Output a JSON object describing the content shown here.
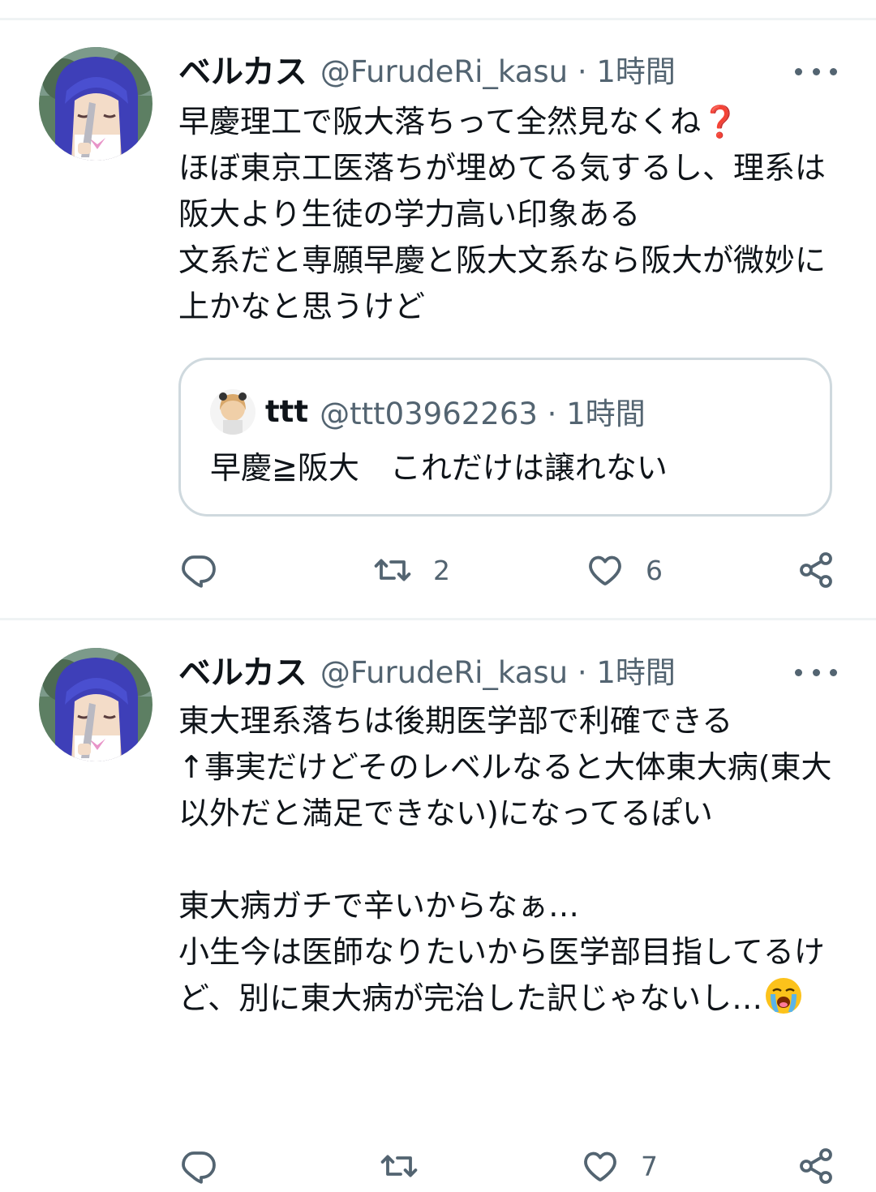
{
  "tweets": [
    {
      "name": "ベルカス",
      "meta": "@FurudeRi_kasu · 1時間",
      "text": "早慶理工で阪大落ちって全然見なくね",
      "text_emoji": "❓",
      "text_rest": "\nほぼ東京工医落ちが埋めてる気するし、理系は阪大より生徒の学力高い印象ある\n文系だと専願早慶と阪大文系なら阪大が微妙に上かなと思うけど",
      "quote": {
        "name": "ttt",
        "meta": "@ttt03962263 · 1時間",
        "text": "早慶≧阪大　これだけは譲れない"
      },
      "reply_count": "",
      "retweet_count": "2",
      "like_count": "6"
    },
    {
      "name": "ベルカス",
      "meta": "@FurudeRi_kasu · 1時間",
      "text": "東大理系落ちは後期医学部で利確できる\n↑事実だけどそのレベルなると大体東大病(東大以外だと満足できない)になってるぽい\n\n東大病ガチで辛いからなぁ…\n小生今は医師なりたいから医学部目指してるけど、別に東大病が完治した訳じゃないし…",
      "text_emoji": "loudly-crying-face",
      "reply_count": "",
      "retweet_count": "",
      "like_count": "7"
    }
  ],
  "icons": {
    "reply": "reply-icon",
    "retweet": "retweet-icon",
    "like": "heart-icon",
    "share": "share-icon",
    "more": "more-icon"
  },
  "colors": {
    "text": "#0f1419",
    "secondary": "#536471",
    "border": "#cfd9de",
    "question_mark": "#d0103a"
  }
}
